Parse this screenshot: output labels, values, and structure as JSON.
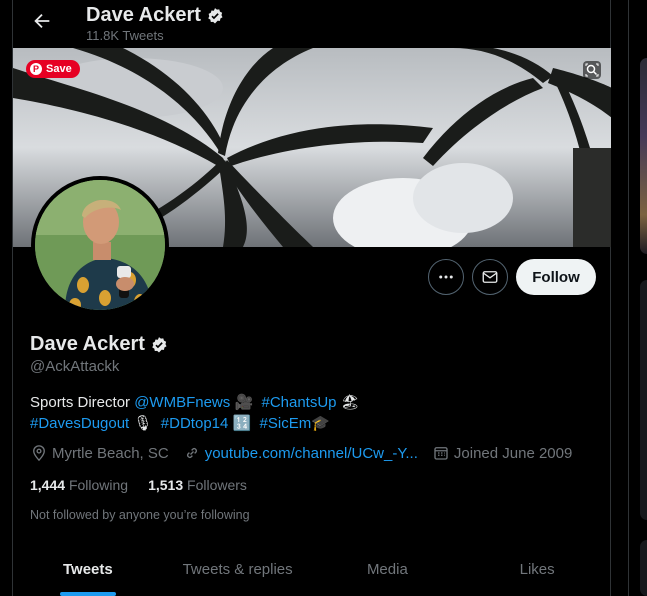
{
  "header": {
    "name": "Dave Ackert",
    "tweet_count": "11.8K Tweets"
  },
  "banner": {
    "save_label": "Save",
    "pin_glyph": "P"
  },
  "actions": {
    "follow_label": "Follow"
  },
  "profile": {
    "name": "Dave Ackert",
    "handle": "@AckAttackk",
    "bio": {
      "line1_text": "Sports Director ",
      "line1_link1": "@WMBFnews",
      "line1_emoji1": "🎥",
      "line1_link2": "#ChantsUp",
      "line1_emoji2": "🏖",
      "line2_link1": "#DavesDugout",
      "line2_emoji1": "🎙",
      "line2_link2": "#DDtop14",
      "line2_emoji2": "🔢",
      "line2_link3": "#SicEm",
      "line2_emoji3": "🎓"
    },
    "location": "Myrtle Beach, SC",
    "website": "youtube.com/channel/UCw_-Y...",
    "joined": "Joined June 2009",
    "following_count": "1,444",
    "following_label": "Following",
    "followers_count": "1,513",
    "followers_label": "Followers",
    "not_followed": "Not followed by anyone you’re following"
  },
  "tabs": [
    {
      "label": "Tweets",
      "active": true
    },
    {
      "label": "Tweets & replies",
      "active": false
    },
    {
      "label": "Media",
      "active": false
    },
    {
      "label": "Likes",
      "active": false
    }
  ],
  "colors": {
    "accent": "#1d9bf0",
    "background": "#000000",
    "muted_text": "#71767b",
    "pinterest_red": "#e60023"
  },
  "icons": [
    "back-arrow-icon",
    "verified-badge-icon",
    "pinterest-icon",
    "lens-icon",
    "more-icon",
    "message-icon",
    "location-icon",
    "link-icon",
    "calendar-icon"
  ]
}
